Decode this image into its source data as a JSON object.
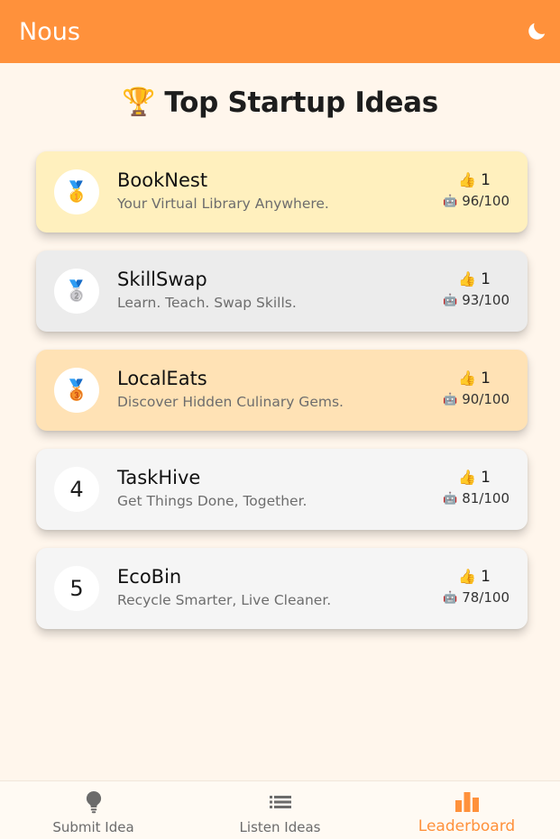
{
  "header": {
    "brand": "Nous",
    "theme_toggle_icon": "moon-icon"
  },
  "page": {
    "title_icon": "🏆",
    "title": "Top Startup Ideas"
  },
  "colors": {
    "header_bg": "#ff913b",
    "page_bg": "#fff6ec",
    "accent": "#ff913b",
    "gold_card": "#fff0be",
    "silver_card": "#ececec",
    "bronze_card": "#ffe2b5",
    "default_card": "#f5f5f5"
  },
  "ideas": [
    {
      "rank_badge": "🥇",
      "rank_icon": "gold-medal-icon",
      "name": "BookNest",
      "tagline": "Your Virtual Library Anywhere.",
      "like_icon": "👍",
      "likes": "1",
      "ai_icon": "🤖",
      "score": "96/100"
    },
    {
      "rank_badge": "🥈",
      "rank_icon": "silver-medal-icon",
      "name": "SkillSwap",
      "tagline": "Learn. Teach. Swap Skills.",
      "like_icon": "👍",
      "likes": "1",
      "ai_icon": "🤖",
      "score": "93/100"
    },
    {
      "rank_badge": "🥉",
      "rank_icon": "bronze-medal-icon",
      "name": "LocalEats",
      "tagline": "Discover Hidden Culinary Gems.",
      "like_icon": "👍",
      "likes": "1",
      "ai_icon": "🤖",
      "score": "90/100"
    },
    {
      "rank_badge": "4",
      "name": "TaskHive",
      "tagline": "Get Things Done, Together.",
      "like_icon": "👍",
      "likes": "1",
      "ai_icon": "🤖",
      "score": "81/100"
    },
    {
      "rank_badge": "5",
      "name": "EcoBin",
      "tagline": "Recycle Smarter, Live Cleaner.",
      "like_icon": "👍",
      "likes": "1",
      "ai_icon": "🤖",
      "score": "78/100"
    }
  ],
  "bottom_nav": {
    "items": [
      {
        "label": "Submit Idea",
        "icon": "lightbulb-icon",
        "active": false
      },
      {
        "label": "Listen Ideas",
        "icon": "list-icon",
        "active": false
      },
      {
        "label": "Leaderboard",
        "icon": "bar-chart-icon",
        "active": true
      }
    ]
  }
}
